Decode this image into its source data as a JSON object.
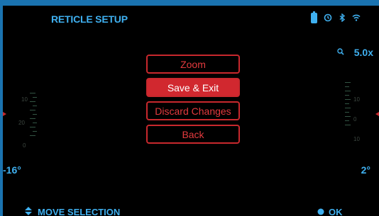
{
  "header": {
    "title": "RETICLE SETUP",
    "zoom": "5.0x"
  },
  "icons": [
    "battery-icon",
    "timer-icon",
    "bluetooth-icon",
    "wifi-icon",
    "zoom-icon",
    "updown-arrow-icon",
    "ok-dot-icon"
  ],
  "menu": {
    "items": [
      "Zoom",
      "Save & Exit",
      "Discard Changes",
      "Back"
    ],
    "selected_index": 1
  },
  "angles": {
    "left": "-16°",
    "right": "2°"
  },
  "scales": {
    "left": [
      "10",
      "20",
      "0"
    ],
    "right": [
      "10",
      "0",
      "10"
    ]
  },
  "footer": {
    "move": "MOVE SELECTION",
    "ok": "OK"
  },
  "colors": {
    "accent": "#3fb0f0",
    "menu_border": "#c8282d",
    "menu_selected": "#d1282f",
    "frame": "#1a73b0"
  }
}
